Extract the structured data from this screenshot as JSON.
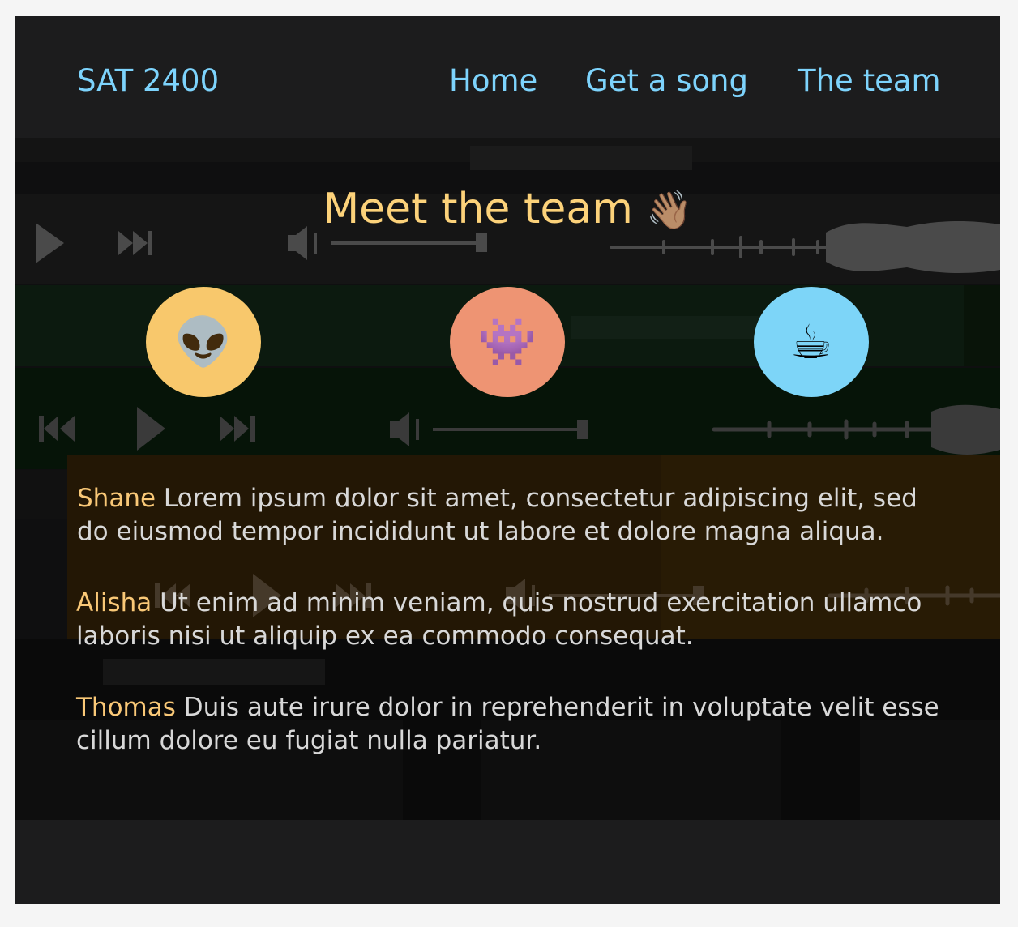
{
  "nav": {
    "brand": "SAT 2400",
    "links": [
      "Home",
      "Get a song",
      "The team"
    ]
  },
  "page": {
    "title": "Meet the team",
    "title_emoji": "👋🏽"
  },
  "team": [
    {
      "avatar": "👽",
      "avatar_name": "alien-icon",
      "color": "#f8c86c",
      "name": "Shane",
      "bio": "Lorem ipsum dolor sit amet, consectetur adipiscing elit, sed do eiusmod tempor incididunt ut labore et dolore magna aliqua."
    },
    {
      "avatar": "👾",
      "avatar_name": "space-invader-icon",
      "color": "#ee9473",
      "name": "Alisha",
      "bio": "Ut enim ad minim veniam, quis nostrud exercitation ullamco laboris nisi ut aliquip ex ea commodo consequat."
    },
    {
      "avatar": "☕",
      "avatar_name": "coffee-icon",
      "color": "#7dd5f8",
      "name": "Thomas",
      "bio": "Duis aute irure dolor in reprehenderit in voluptate velit esse cillum dolore eu fugiat nulla pariatur."
    }
  ],
  "colors": {
    "accent_blue": "#7dd3fc",
    "accent_gold": "#fcd27a",
    "background": "#1b1b1b"
  }
}
